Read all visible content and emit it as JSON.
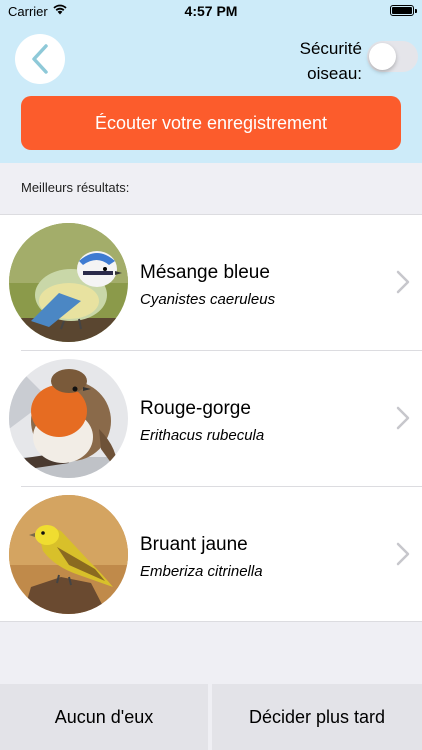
{
  "status": {
    "carrier": "Carrier",
    "time": "4:57 PM"
  },
  "header": {
    "safety_label": "Sécurité oiseau:",
    "safety_enabled": false,
    "listen_label": "Écouter votre enregistrement"
  },
  "results": {
    "title": "Meilleurs résultats:",
    "items": [
      {
        "common": "Mésange bleue",
        "scientific": "Cyanistes caeruleus"
      },
      {
        "common": "Rouge-gorge",
        "scientific": "Erithacus rubecula"
      },
      {
        "common": "Bruant jaune",
        "scientific": "Emberiza citrinella"
      }
    ]
  },
  "footer": {
    "none_label": "Aucun d'eux",
    "later_label": "Décider plus tard"
  },
  "colors": {
    "header_bg": "#cdebf9",
    "accent": "#fc5c2c",
    "back_arrow": "#8ec9d8"
  }
}
